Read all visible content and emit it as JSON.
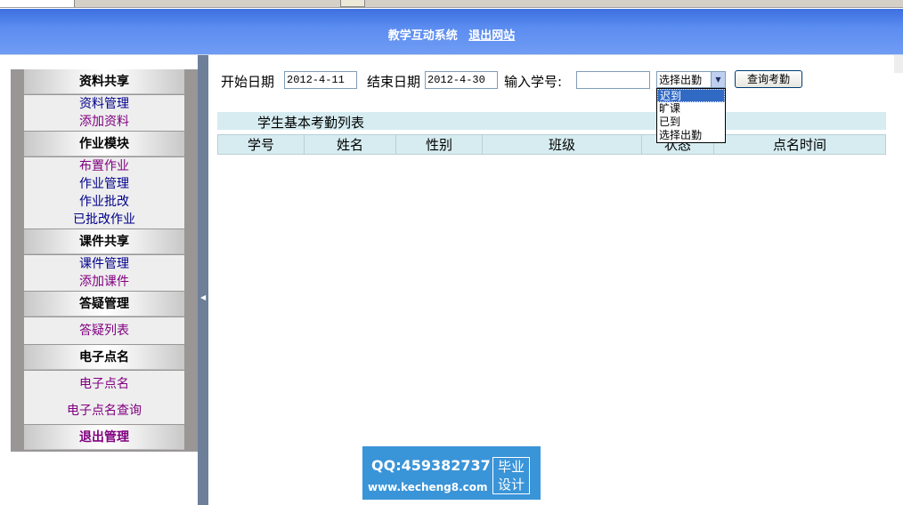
{
  "header": {
    "title": "教学互动系统",
    "logout": "退出网站"
  },
  "sidebar": {
    "sections": [
      {
        "title": "资料共享",
        "items": [
          "资料管理",
          "添加资料"
        ]
      },
      {
        "title": "作业模块",
        "items": [
          "布置作业",
          "作业管理",
          "作业批改",
          "已批改作业"
        ]
      },
      {
        "title": "课件共享",
        "items": [
          "课件管理",
          "添加课件"
        ]
      },
      {
        "title": "答疑管理",
        "items": [
          "答疑列表"
        ]
      },
      {
        "title": "电子点名",
        "items": [
          "电子点名",
          "电子点名查询"
        ]
      },
      {
        "title": "退出管理",
        "items": []
      }
    ]
  },
  "form": {
    "start_label": "开始日期",
    "start_value": "2012-4-11",
    "end_label": "结束日期",
    "end_value": "2012-4-30",
    "student_label": "输入学号:",
    "student_value": "",
    "status_selected": "选择出勤",
    "status_options": [
      "迟到",
      "旷课",
      "已到",
      "选择出勤"
    ],
    "query_button": "查询考勤"
  },
  "list": {
    "title": "学生基本考勤列表",
    "columns": [
      "学号",
      "姓名",
      "性别",
      "班级",
      "状态",
      "点名时间"
    ]
  },
  "watermark": {
    "qq": "QQ:459382737",
    "url": "www.kecheng8.com",
    "badge_line1": "毕业",
    "badge_line2": "设计"
  }
}
